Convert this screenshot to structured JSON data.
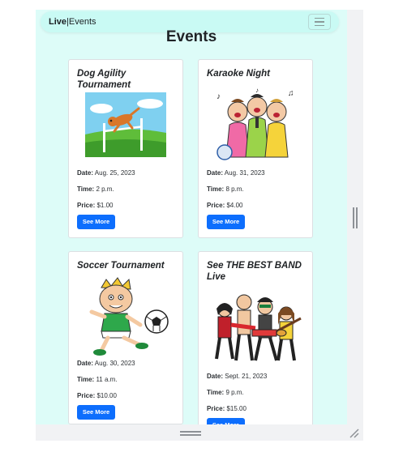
{
  "navbar": {
    "brand_bold": "Live",
    "brand_sep": "|",
    "brand_rest": "Events"
  },
  "page": {
    "title": "Events"
  },
  "labels": {
    "date": "Date:",
    "time": "Time:",
    "price": "Price:"
  },
  "events": [
    {
      "title": "Dog Agility Tournament",
      "date": "Aug. 25, 2023",
      "time": "2 p.m.",
      "price": "$1.00",
      "button": "See More",
      "image_icon": "dog-agility-illustration"
    },
    {
      "title": "Karaoke Night",
      "date": "Aug. 31, 2023",
      "time": "8 p.m.",
      "price": "$4.00",
      "button": "See More",
      "image_icon": "karaoke-singers-illustration"
    },
    {
      "title": "Soccer Tournament",
      "date": "Aug. 30, 2023",
      "time": "11 a.m.",
      "price": "$10.00",
      "button": "See More",
      "image_icon": "soccer-kid-illustration"
    },
    {
      "title": "See THE BEST BAND Live",
      "date": "Sept. 21, 2023",
      "time": "9 p.m.",
      "price": "$15.00",
      "button": "See More",
      "image_icon": "rock-band-illustration"
    }
  ],
  "colors": {
    "viewport_bg": "#ddfcf8",
    "navbar_bg": "#c9faf4",
    "button_bg": "#0d6efd"
  }
}
